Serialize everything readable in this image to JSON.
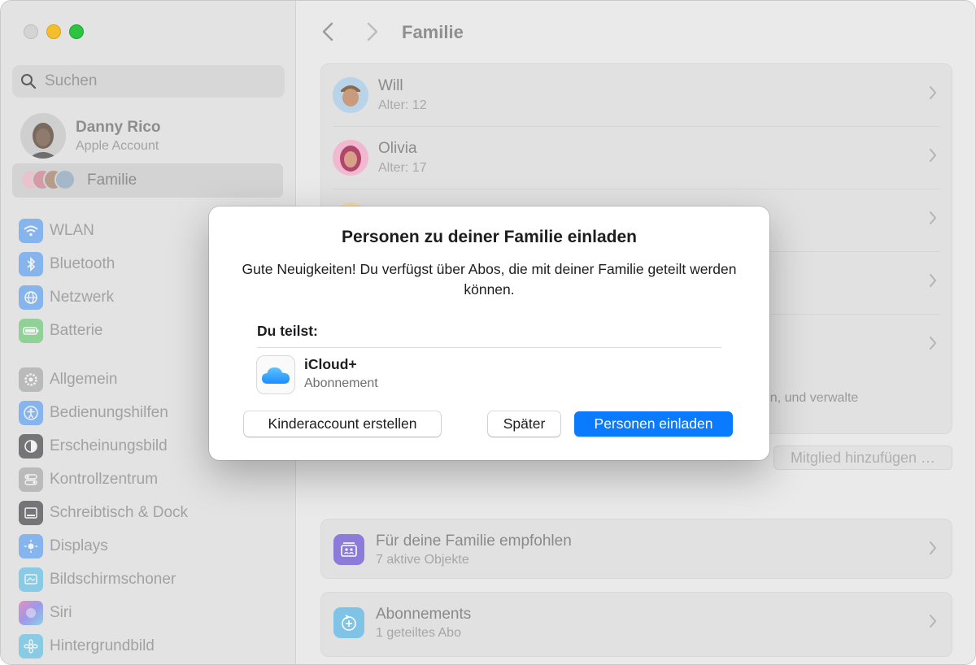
{
  "sidebar": {
    "search_placeholder": "Suchen",
    "account": {
      "name": "Danny Rico",
      "subtitle": "Apple Account"
    },
    "family_label": "Familie",
    "groups": [
      [
        {
          "label": "WLAN",
          "icon": "wifi-icon",
          "color": "#3b8ff5"
        },
        {
          "label": "Bluetooth",
          "icon": "bluetooth-icon",
          "color": "#3b8ff5"
        },
        {
          "label": "Netzwerk",
          "icon": "globe-icon",
          "color": "#3b8ff5"
        },
        {
          "label": "Batterie",
          "icon": "battery-icon",
          "color": "#4cc45a"
        }
      ],
      [
        {
          "label": "Allgemein",
          "icon": "gear-icon",
          "color": "#9a9a9a"
        },
        {
          "label": "Bedienungshilfen",
          "icon": "accessibility-icon",
          "color": "#3b8ff5"
        },
        {
          "label": "Erscheinungsbild",
          "icon": "appearance-icon",
          "color": "#1d1d1f"
        },
        {
          "label": "Kontrollzentrum",
          "icon": "control-center-icon",
          "color": "#9a9a9a"
        },
        {
          "label": "Schreibtisch & Dock",
          "icon": "dock-icon",
          "color": "#1d1d1f"
        },
        {
          "label": "Displays",
          "icon": "displays-icon",
          "color": "#3b8ff5"
        },
        {
          "label": "Bildschirmschoner",
          "icon": "screensaver-icon",
          "color": "#40b8e8"
        },
        {
          "label": "Siri",
          "icon": "siri-icon",
          "color": "#c04cd8"
        },
        {
          "label": "Hintergrundbild",
          "icon": "wallpaper-icon",
          "color": "#40b8e8"
        }
      ]
    ]
  },
  "main": {
    "title": "Familie",
    "members": [
      {
        "name": "Will",
        "age": "Alter: 12",
        "color": "#b9d4e8"
      },
      {
        "name": "Olivia",
        "age": "Alter: 17",
        "color": "#f2b8cf"
      },
      {
        "name": "",
        "age": "",
        "color": "#f2d9a6"
      },
      {
        "name": "",
        "age": "",
        "color": "#e1e1e1"
      },
      {
        "name": "",
        "age": "",
        "color": "#e1e1e1"
      }
    ],
    "members_note": "nen, und verwalte",
    "add_member_button": "Mitglied hinzufügen …",
    "recommended": {
      "title": "Für deine Familie empfohlen",
      "subtitle": "7 aktive Objekte",
      "color": "#8c7bd9"
    },
    "subscriptions": {
      "title": "Abonnements",
      "subtitle": "1 geteiltes Abo",
      "color": "#7fc3e6"
    }
  },
  "dialog": {
    "title": "Personen zu deiner Familie einladen",
    "message": "Gute Neuigkeiten! Du verfügst über Abos, die mit deiner Familie geteilt werden können.",
    "sharing_label": "Du teilst:",
    "item": {
      "name": "iCloud+",
      "subtitle": "Abonnement",
      "icon": "icloud-icon"
    },
    "buttons": {
      "create_child": "Kinderaccount erstellen",
      "later": "Später",
      "invite": "Personen einladen"
    },
    "accent": "#0a7aff"
  }
}
